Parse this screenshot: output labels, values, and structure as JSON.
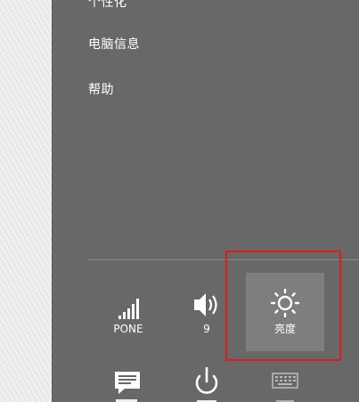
{
  "menu": {
    "items": [
      {
        "label": "个性化"
      },
      {
        "label": "电脑信息"
      },
      {
        "label": "帮助"
      }
    ]
  },
  "quick_settings": {
    "network": {
      "label": "PONE",
      "icon": "signal-bars-icon"
    },
    "volume": {
      "label": "9",
      "icon": "speaker-icon"
    },
    "brightness": {
      "label": "亮度",
      "icon": "sun-icon"
    }
  },
  "bottom_row": [
    {
      "icon": "notifications-icon"
    },
    {
      "icon": "power-icon"
    },
    {
      "icon": "keyboard-icon"
    }
  ],
  "colors": {
    "panel": "#686868",
    "highlight": "#e01b1b",
    "active_tile": "#7e7e7e"
  }
}
